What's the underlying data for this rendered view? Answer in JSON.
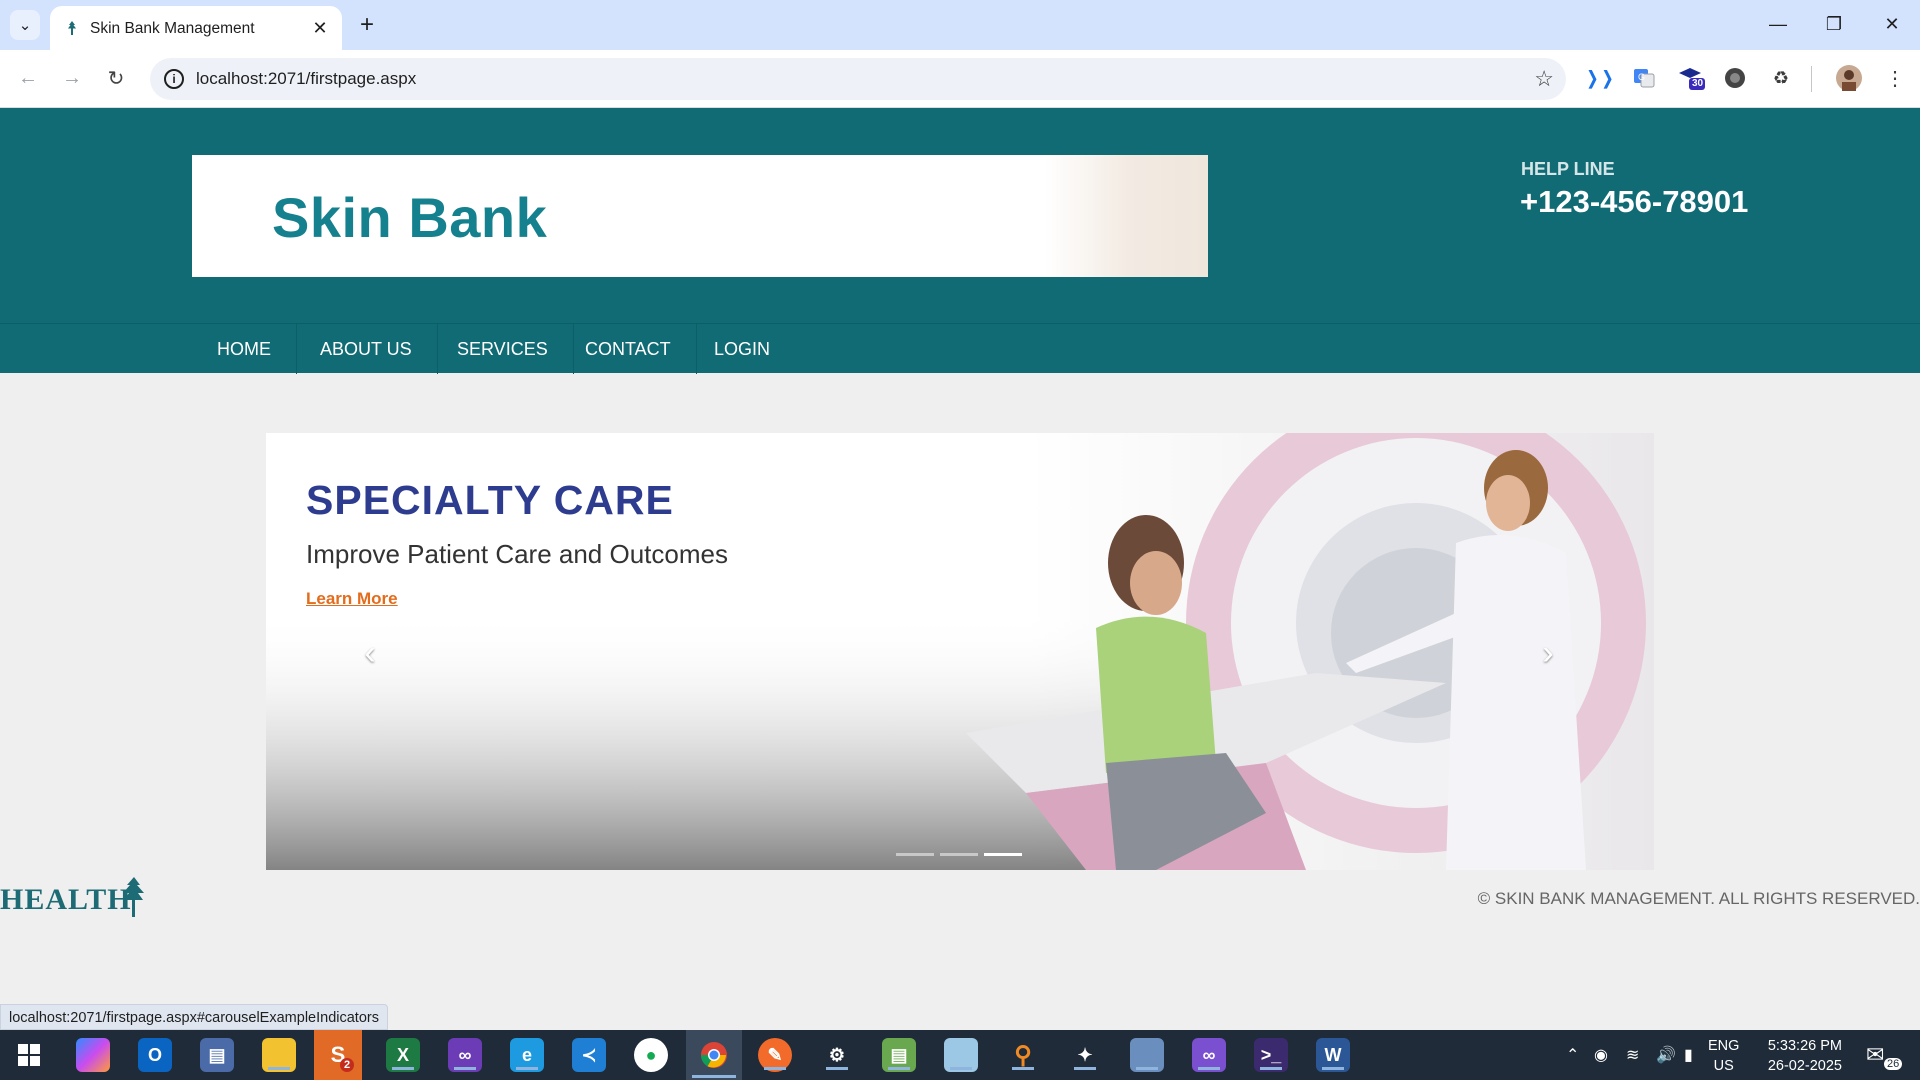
{
  "browser": {
    "tab_title": "Skin Bank Management",
    "url": "localhost:2071/firstpage.aspx",
    "status_url": "localhost:2071/firstpage.aspx#carouselExampleIndicators",
    "extension_badge": "30",
    "icons": {
      "tab_search": "chevron-down-icon",
      "close_tab": "close-icon",
      "new_tab": "plus-icon",
      "back": "arrow-left-icon",
      "forward": "arrow-right-icon",
      "reload": "reload-icon",
      "site_info": "info-icon",
      "bookmark": "star-icon",
      "extensions": "puzzle-icon",
      "menu": "kebab-icon"
    }
  },
  "site": {
    "brand_title": "Skin Bank",
    "helpline_label": "HELP LINE",
    "helpline_number": "+123-456-78901",
    "nav": [
      "HOME",
      "ABOUT US",
      "SERVICES",
      "CONTACT",
      "LOGIN"
    ],
    "slide": {
      "title": "SPECIALTY CARE",
      "subtitle": "Improve Patient Care and Outcomes",
      "link": "Learn More"
    },
    "carousel_indicator_count": 3,
    "carousel_active_index": 2,
    "footer_logo": "HEALTH",
    "copyright": "© SKIN BANK MANAGEMENT. ALL RIGHTS RESERVED."
  },
  "taskbar": {
    "lang_primary": "ENG",
    "lang_secondary": "US",
    "time": "5:33:26 PM",
    "date": "26-02-2025",
    "notification_count": "26",
    "skype_badge": "2",
    "apps": [
      "start-icon",
      "copilot-icon",
      "outlook-icon",
      "network-tool-icon",
      "file-explorer-icon",
      "skype-icon",
      "excel-icon",
      "visual-studio-icon",
      "edge-icon",
      "vscode-icon",
      "mongodb-icon",
      "chrome-icon",
      "pen-icon",
      "settings-icon",
      "notepad-icon",
      "paper-icon",
      "search-tool-icon",
      "compass-icon",
      "folder-icon",
      "visual-studio-alt-icon",
      "terminal-icon",
      "word-icon"
    ]
  },
  "colors": {
    "header_teal": "#116b75",
    "brand_teal": "#16818e",
    "slide_title_blue": "#2e3c8f",
    "link_orange": "#e36c1d",
    "tab_strip": "#d3e3fd",
    "taskbar": "#1f2b38"
  }
}
